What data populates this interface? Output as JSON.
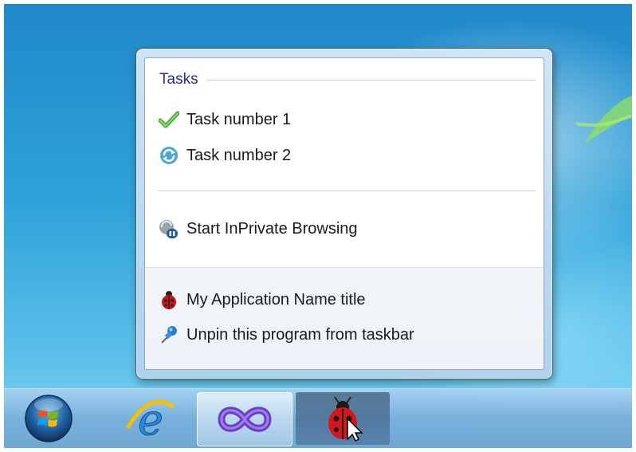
{
  "jumplist": {
    "tasks_header": "Tasks",
    "tasks": [
      {
        "label": "Task number 1",
        "icon": "checkmark-icon"
      },
      {
        "label": "Task number 2",
        "icon": "refresh-icon"
      }
    ],
    "extra_task": {
      "label": "Start InPrivate Browsing",
      "icon": "inprivate-icon"
    },
    "footer": [
      {
        "label": "My Application Name title",
        "icon": "ladybug-icon"
      },
      {
        "label": "Unpin this program from taskbar",
        "icon": "unpin-icon"
      }
    ]
  },
  "taskbar": {
    "items": [
      "start-orb",
      "internet-explorer-icon",
      "visual-studio-icon",
      "ladybug-app-icon"
    ]
  },
  "colors": {
    "header_text": "#1e3287",
    "desktop_blue": "#2fa3d9"
  }
}
